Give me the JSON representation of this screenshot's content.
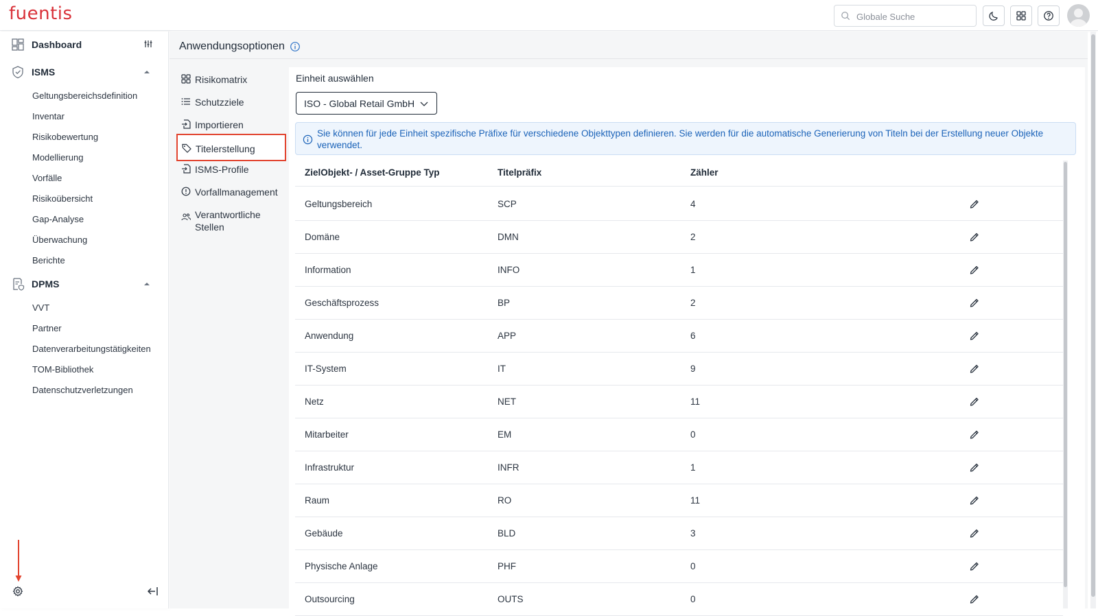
{
  "app": {
    "logo": "fuentis"
  },
  "topbar": {
    "search_placeholder": "Globale Suche",
    "icons": [
      "moon-icon",
      "apps-grid-icon",
      "help-icon",
      "avatar"
    ]
  },
  "sidebar": {
    "dashboard": {
      "label": "Dashboard"
    },
    "isms": {
      "label": "ISMS",
      "items": [
        "Geltungsbereichsdefinition",
        "Inventar",
        "Risikobewertung",
        "Modellierung",
        "Vorfälle",
        "Risikoübersicht",
        "Gap-Analyse",
        "Überwachung",
        "Berichte"
      ]
    },
    "dpms": {
      "label": "DPMS",
      "items": [
        "VVT",
        "Partner",
        "Datenverarbeitungstätigkeiten",
        "TOM-Bibliothek",
        "Datenschutzverletzungen"
      ]
    }
  },
  "page": {
    "title": "Anwendungsoptionen",
    "options": [
      {
        "label": "Risikomatrix",
        "icon": "grid-icon"
      },
      {
        "label": "Schutzziele",
        "icon": "list-icon"
      },
      {
        "label": "Importieren",
        "icon": "import-icon"
      },
      {
        "label": "Titelerstellung",
        "icon": "tag-icon",
        "active": true
      },
      {
        "label": "ISMS-Profile",
        "icon": "import-icon"
      },
      {
        "label": "Vorfallmanagement",
        "icon": "alert-circle-icon"
      },
      {
        "label": "Verantwortliche Stellen",
        "icon": "people-icon"
      }
    ],
    "unit_label": "Einheit auswählen",
    "unit_selected": "ISO - Global Retail GmbH",
    "info_text": "Sie können für jede Einheit spezifische Präfixe für verschiedene Objekttypen definieren. Sie werden für die automatische Generierung von Titeln bei der Erstellung neuer Objekte verwendet.",
    "table": {
      "headers": [
        "ZielObjekt- / Asset-Gruppe Typ",
        "Titelpräfix",
        "Zähler"
      ],
      "rows": [
        [
          "Geltungsbereich",
          "SCP",
          "4"
        ],
        [
          "Domäne",
          "DMN",
          "2"
        ],
        [
          "Information",
          "INFO",
          "1"
        ],
        [
          "Geschäftsprozess",
          "BP",
          "2"
        ],
        [
          "Anwendung",
          "APP",
          "6"
        ],
        [
          "IT-System",
          "IT",
          "9"
        ],
        [
          "Netz",
          "NET",
          "11"
        ],
        [
          "Mitarbeiter",
          "EM",
          "0"
        ],
        [
          "Infrastruktur",
          "INFR",
          "1"
        ],
        [
          "Raum",
          "RO",
          "11"
        ],
        [
          "Gebäude",
          "BLD",
          "3"
        ],
        [
          "Physische Anlage",
          "PHF",
          "0"
        ],
        [
          "Outsourcing",
          "OUTS",
          "0"
        ]
      ]
    }
  },
  "colors": {
    "brand": "#d9323a",
    "highlight": "#e2442f",
    "info": "#1a62b8"
  }
}
